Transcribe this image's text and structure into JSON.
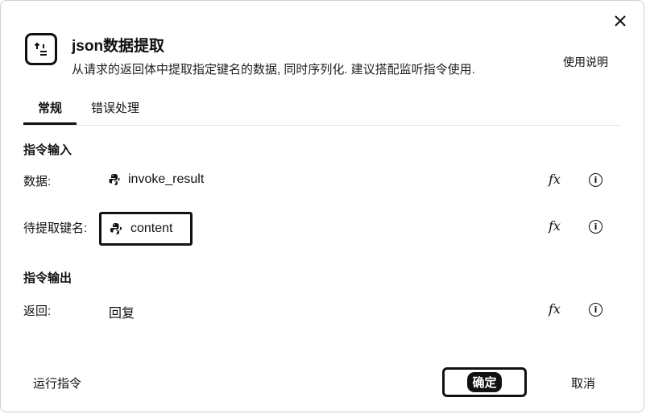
{
  "dialog": {
    "title": "json数据提取",
    "subtitle": "从请求的返回体中提取指定键名的数据, 同时序列化. 建议搭配监听指令使用.",
    "help_link": "使用说明",
    "close_icon": "close-icon",
    "app_icon": "json-extract-icon"
  },
  "tabs": [
    {
      "label": "常规",
      "active": true
    },
    {
      "label": "错误处理",
      "active": false
    }
  ],
  "input_section": {
    "title": "指令输入",
    "rows": [
      {
        "label": "数据:",
        "value": "invoke_result",
        "icon": "python-icon"
      },
      {
        "label": "待提取键名:",
        "value": "content",
        "icon": "python-icon"
      }
    ]
  },
  "output_section": {
    "title": "指令输出",
    "rows": [
      {
        "label": "返回:",
        "value": "回复"
      }
    ]
  },
  "row_actions": {
    "fx_label": "fx",
    "info_label": "i"
  },
  "footer": {
    "run_label": "运行指令",
    "confirm_label": "确定",
    "cancel_label": "取消"
  }
}
